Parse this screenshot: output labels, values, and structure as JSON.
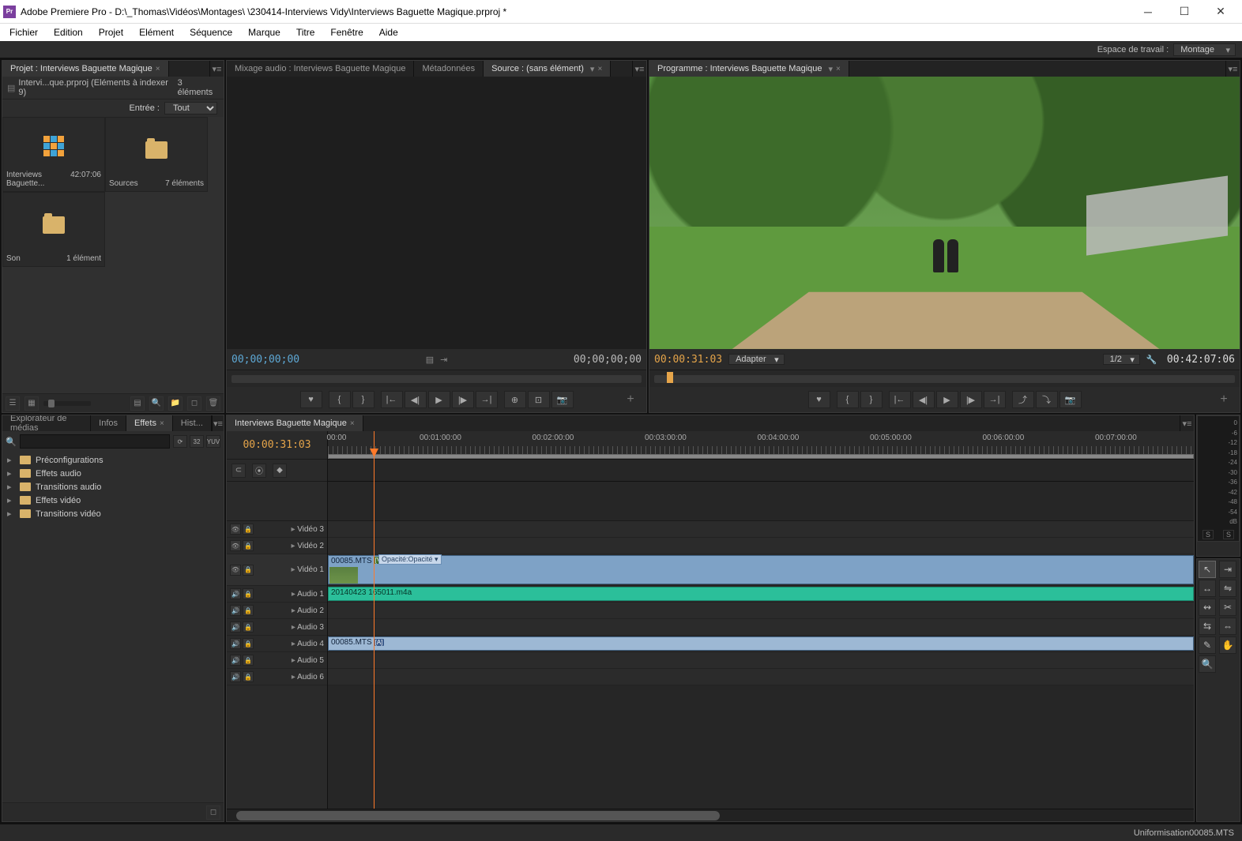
{
  "window": {
    "app_prefix": "Adobe Premiere Pro - ",
    "path": "D:\\_Thomas\\Vidéos\\Montages\\                          \\230414-Interviews Vidy\\Interviews Baguette Magique.prproj *"
  },
  "menu": [
    "Fichier",
    "Edition",
    "Projet",
    "Elément",
    "Séquence",
    "Marque",
    "Titre",
    "Fenêtre",
    "Aide"
  ],
  "workspace": {
    "label": "Espace de travail :",
    "value": "Montage"
  },
  "project": {
    "tab": "Projet : Interviews Baguette Magique",
    "info_line": "Intervi...que.prproj (Eléments à indexer 9)",
    "item_count": "3 éléments",
    "entry_label": "Entrée :",
    "entry_value": "Tout",
    "bins": [
      {
        "name": "Interviews Baguette...",
        "meta": "42:07:06",
        "type": "sequence"
      },
      {
        "name": "Sources",
        "meta": "7 éléments",
        "type": "folder"
      },
      {
        "name": "Son",
        "meta": "1 élément",
        "type": "folder"
      }
    ]
  },
  "source": {
    "tabs": [
      "Mixage audio : Interviews Baguette Magique",
      "Métadonnées",
      "Source : (sans élément)"
    ],
    "active_tab": 2,
    "tc_left": "00;00;00;00",
    "tc_right": "00;00;00;00"
  },
  "program": {
    "tab": "Programme : Interviews Baguette Magique",
    "tc_left": "00:00:31:03",
    "fit_label": "Adapter",
    "zoom": "1/2",
    "tc_right": "00:42:07:06"
  },
  "effects": {
    "tabs": [
      "Explorateur de médias",
      "Infos",
      "Effets",
      "Hist..."
    ],
    "active_tab": 2,
    "search_placeholder": "",
    "badges": [
      "⟳",
      "32",
      "YUV"
    ],
    "items": [
      "Préconfigurations",
      "Effets audio",
      "Transitions audio",
      "Effets vidéo",
      "Transitions vidéo"
    ]
  },
  "timeline": {
    "tab": "Interviews Baguette Magique",
    "playhead_tc": "00:00:31:03",
    "ruler": [
      "00:00",
      "00:01:00:00",
      "00:02:00:00",
      "00:03:00:00",
      "00:04:00:00",
      "00:05:00:00",
      "00:06:00:00",
      "00:07:00:00"
    ],
    "video_tracks": [
      "Vidéo 3",
      "Vidéo 2",
      "Vidéo 1"
    ],
    "audio_tracks": [
      "Audio 1",
      "Audio 2",
      "Audio 3",
      "Audio 4",
      "Audio 5",
      "Audio 6"
    ],
    "clips": {
      "v1_name": "00085.MTS",
      "v1_badge": "[V]",
      "v1_effect": "Opacité:Opacité",
      "a1_name": "20140423 165011.m4a",
      "a4_name": "00085.MTS",
      "a4_badge": "[A]"
    }
  },
  "audiometer": {
    "ticks": [
      "0",
      "-6",
      "-12",
      "-18",
      "-24",
      "-30",
      "-36",
      "-42",
      "-48",
      "-54",
      "dB"
    ],
    "solo": [
      "S",
      "S"
    ]
  },
  "statusbar": "Uniformisation00085.MTS"
}
